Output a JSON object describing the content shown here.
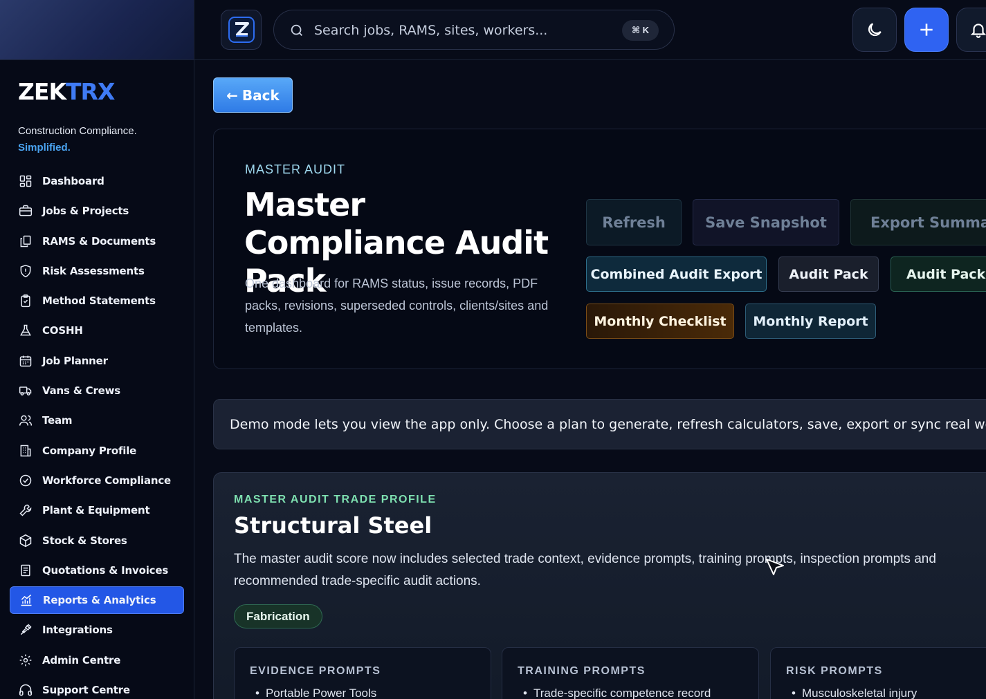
{
  "brand": {
    "part1": "ZEK",
    "part2": "TRX",
    "tagline": "Construction Compliance.",
    "tagline_accent": "Simplified."
  },
  "sidebar": {
    "items": [
      {
        "label": "Dashboard",
        "icon": "dashboard-icon",
        "active": false
      },
      {
        "label": "Jobs & Projects",
        "icon": "briefcase-icon",
        "active": false
      },
      {
        "label": "RAMS & Documents",
        "icon": "documents-icon",
        "active": false
      },
      {
        "label": "Risk Assessments",
        "icon": "shield-icon",
        "active": false
      },
      {
        "label": "Method Statements",
        "icon": "clipboard-icon",
        "active": false
      },
      {
        "label": "COSHH",
        "icon": "flask-icon",
        "active": false
      },
      {
        "label": "Job Planner",
        "icon": "calendar-icon",
        "active": false
      },
      {
        "label": "Vans & Crews",
        "icon": "truck-icon",
        "active": false
      },
      {
        "label": "Team",
        "icon": "users-icon",
        "active": false
      },
      {
        "label": "Company Profile",
        "icon": "building-icon",
        "active": false
      },
      {
        "label": "Workforce Compliance",
        "icon": "check-circle-icon",
        "active": false
      },
      {
        "label": "Plant & Equipment",
        "icon": "wrench-icon",
        "active": false
      },
      {
        "label": "Stock & Stores",
        "icon": "box-icon",
        "active": false
      },
      {
        "label": "Quotations & Invoices",
        "icon": "invoice-icon",
        "active": false
      },
      {
        "label": "Reports & Analytics",
        "icon": "chart-icon",
        "active": true
      },
      {
        "label": "Integrations",
        "icon": "plug-icon",
        "active": false
      },
      {
        "label": "Admin Centre",
        "icon": "gear-icon",
        "active": false
      },
      {
        "label": "Support Centre",
        "icon": "headphones-icon",
        "active": false
      }
    ]
  },
  "topbar": {
    "search_placeholder": "Search jobs, RAMS, sites, workers...",
    "shortcut": "⌘ K"
  },
  "main": {
    "back_label": "Back",
    "hero": {
      "eyebrow": "MASTER AUDIT",
      "title": "Master Compliance Audit Pack",
      "description": "One dashboard for RAMS status, issue records, PDF packs, revisions, superseded controls, clients/sites and templates.",
      "buttons": {
        "refresh": "Refresh",
        "save_snapshot": "Save Snapshot",
        "export_summary": "Export Summary",
        "combined_export": "Combined Audit Export",
        "audit_pack": "Audit Pack",
        "audit_pack_r": "Audit Pack R",
        "monthly_checklist": "Monthly Checklist",
        "monthly_report": "Monthly Report"
      }
    },
    "demo_notice": "Demo mode lets you view the app only. Choose a plan to generate, refresh calculators, save, export or sync real work.",
    "trade": {
      "eyebrow": "MASTER AUDIT TRADE PROFILE",
      "title": "Structural Steel",
      "description": "The master audit score now includes selected trade context, evidence prompts, training prompts, inspection prompts and recommended trade-specific audit actions.",
      "tag": "Fabrication",
      "cards": [
        {
          "title": "EVIDENCE PROMPTS",
          "item": "Portable Power Tools"
        },
        {
          "title": "TRAINING PROMPTS",
          "item": "Trade-specific competence record"
        },
        {
          "title": "RISK PROMPTS",
          "item": "Musculoskeletal injury"
        }
      ]
    }
  },
  "colors": {
    "accent": "#2f63f2",
    "brand_blue": "#3f7bf5",
    "eyebrow": "#9fd8ee",
    "trade_eyebrow": "#7ee0b0"
  }
}
